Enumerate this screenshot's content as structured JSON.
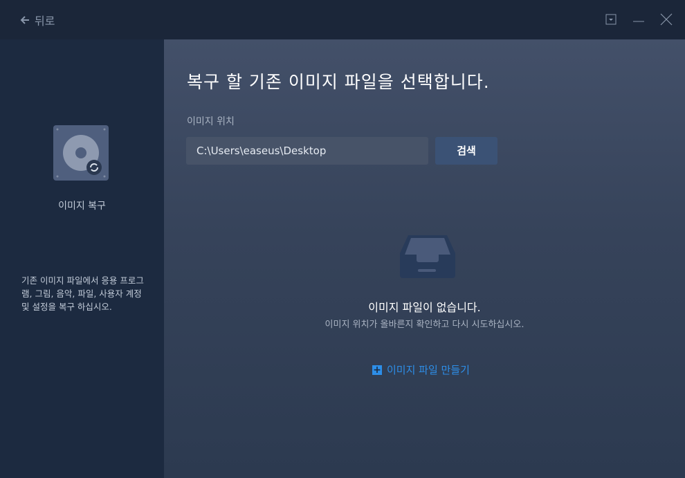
{
  "titlebar": {
    "back_label": "뒤로"
  },
  "sidebar": {
    "label": "이미지 복구",
    "description": "기존 이미지 파일에서 응용 프로그램, 그림, 음악, 파일, 사용자 계정 및 설정을 복구 하십시오."
  },
  "main": {
    "title": "복구 할 기존 이미지 파일을 선택합니다.",
    "location_label": "이미지 위치",
    "location_value": "C:\\Users\\easeus\\Desktop",
    "search_label": "검색",
    "empty_title": "이미지 파일이 없습니다.",
    "empty_subtitle": "이미지 위치가 올바른지 확인하고 다시 시도하십시오.",
    "create_label": "이미지 파일 만들기"
  },
  "colors": {
    "accent": "#2d8ee8"
  }
}
